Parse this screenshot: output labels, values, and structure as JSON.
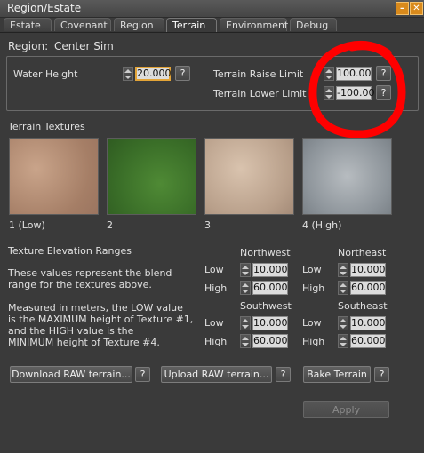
{
  "window": {
    "title": "Region/Estate",
    "minimize_glyph": "–",
    "close_glyph": "✕"
  },
  "tabs": [
    "Estate",
    "Covenant",
    "Region",
    "Terrain",
    "Environment",
    "Debug"
  ],
  "active_tab": "Terrain",
  "region": {
    "label": "Region:",
    "name": "Center Sim"
  },
  "water": {
    "label": "Water Height",
    "value": "20.000"
  },
  "raise": {
    "label": "Terrain Raise Limit",
    "value": "100.00"
  },
  "lower": {
    "label": "Terrain Lower Limit",
    "value": "-100.00"
  },
  "help_glyph": "?",
  "textures": {
    "title": "Terrain Textures",
    "labels": [
      "1 (Low)",
      "2",
      "3",
      "4 (High)"
    ]
  },
  "elevation": {
    "title": "Texture Elevation Ranges",
    "desc1": [
      "These values represent the blend",
      "range for the textures above."
    ],
    "desc2": [
      "Measured in meters, the LOW value",
      "is the MAXIMUM height of Texture #1,",
      "and the HIGH value is the",
      "MINIMUM height of Texture #4."
    ],
    "low_label": "Low",
    "high_label": "High",
    "corners": {
      "northwest": {
        "label": "Northwest",
        "low": "10.000",
        "high": "60.000"
      },
      "northeast": {
        "label": "Northeast",
        "low": "10.000",
        "high": "60.000"
      },
      "southwest": {
        "label": "Southwest",
        "low": "10.000",
        "high": "60.000"
      },
      "southeast": {
        "label": "Southeast",
        "low": "10.000",
        "high": "60.000"
      }
    }
  },
  "buttons": {
    "download": "Download RAW terrain...",
    "upload": "Upload RAW terrain...",
    "bake": "Bake Terrain",
    "apply": "Apply"
  },
  "annotation_color": "#ff0000"
}
